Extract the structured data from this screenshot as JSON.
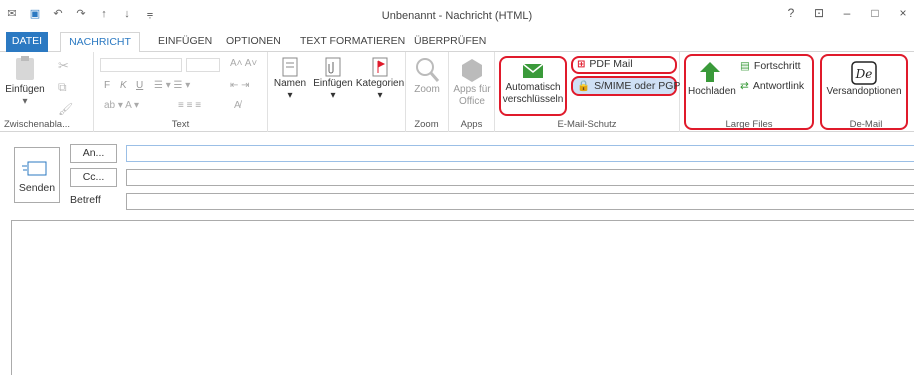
{
  "window": {
    "title": "Unbenannt - Nachricht (HTML)",
    "controls": [
      "?",
      "⊡",
      "–",
      "□",
      "×"
    ]
  },
  "qat": [
    "mail-icon",
    "save-icon",
    "undo-icon",
    "redo-icon",
    "up-icon",
    "down-icon",
    "customize-icon"
  ],
  "tabs": [
    {
      "label": "DATEI"
    },
    {
      "label": "NACHRICHT"
    },
    {
      "label": "EINFÜGEN"
    },
    {
      "label": "OPTIONEN"
    },
    {
      "label": "TEXT FORMATIEREN"
    },
    {
      "label": "ÜBERPRÜFEN"
    }
  ],
  "ribbon": {
    "clipboard": {
      "paste": "Einfügen",
      "label": "Zwischenabla..."
    },
    "text": {
      "bold": "F",
      "italic": "K",
      "underline": "U",
      "label": "Text"
    },
    "names": {
      "label": "Namen"
    },
    "insert": {
      "label": "Einfügen"
    },
    "tags": {
      "label": "Kategorien"
    },
    "zoom": {
      "button": "Zoom",
      "label": "Zoom"
    },
    "apps": {
      "button_line1": "Apps für",
      "button_line2": "Office",
      "label": "Apps"
    },
    "email_protection": {
      "auto_line1": "Automatisch",
      "auto_line2": "verschlüsseln",
      "pdf_mail": "PDF Mail",
      "smime": "S/MIME oder PGP",
      "label": "E-Mail-Schutz"
    },
    "large_files": {
      "upload": "Hochladen",
      "progress": "Fortschritt",
      "reply_link": "Antwortlink",
      "label": "Large Files"
    },
    "demail": {
      "options": "Versandoptionen",
      "label": "De-Mail"
    }
  },
  "compose": {
    "send": "Senden",
    "to": "An...",
    "cc": "Cc...",
    "subject": "Betreff"
  },
  "colors": {
    "accent": "#2b79c2",
    "highlight": "#e01a2b"
  }
}
